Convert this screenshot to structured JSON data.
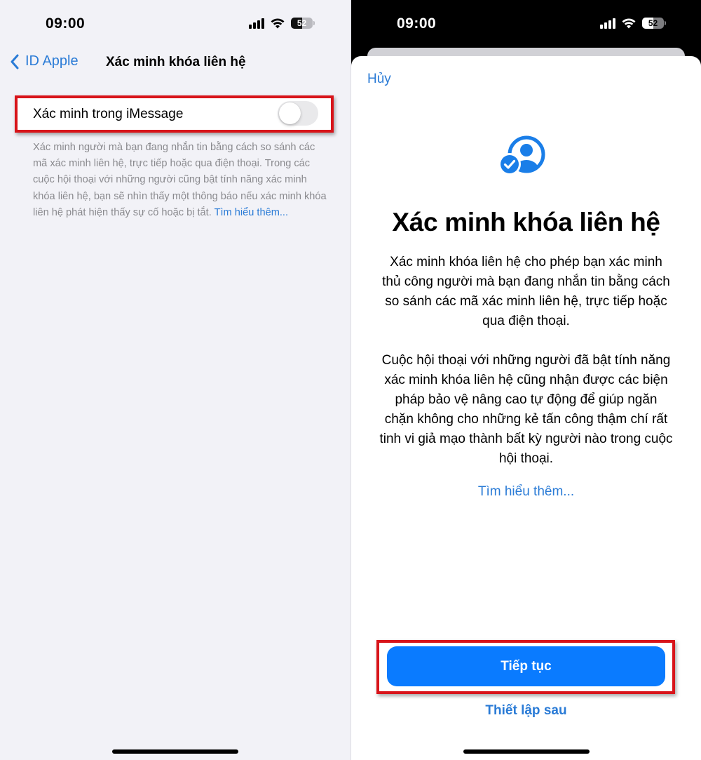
{
  "left_screen": {
    "status_bar": {
      "time": "09:00",
      "battery": "52"
    },
    "nav": {
      "back_label": "ID Apple",
      "title": "Xác minh khóa liên hệ"
    },
    "setting": {
      "label": "Xác minh trong iMessage",
      "toggle_on": false
    },
    "footer": {
      "text": "Xác minh người mà bạn đang nhắn tin bằng cách so sánh các mã xác minh liên hệ, trực tiếp hoặc qua điện thoại. Trong các cuộc hội thoại với những người cũng bật tính năng xác minh khóa liên hệ, bạn sẽ nhìn thấy một thông báo nếu xác minh khóa liên hệ phát hiện thấy sự cố hoặc bị tắt. ",
      "link": "Tìm hiểu thêm..."
    }
  },
  "right_screen": {
    "status_bar": {
      "time": "09:00",
      "battery": "52"
    },
    "sheet": {
      "cancel_label": "Hủy",
      "icon": "person-verified-icon",
      "title": "Xác minh khóa liên hệ",
      "body_1": "Xác minh khóa liên hệ cho phép bạn xác minh thủ công người mà bạn đang nhắn tin bằng cách so sánh các mã xác minh liên hệ, trực tiếp hoặc qua điện thoại.",
      "body_2": "Cuộc hội thoại với những người đã bật tính năng xác minh khóa liên hệ cũng nhận được các biện pháp bảo vệ nâng cao tự động để giúp ngăn chặn không cho những kẻ tấn công thậm chí rất tinh vi giả mạo thành bất kỳ người nào trong cuộc hội thoại.",
      "learn_more": "Tìm hiểu thêm...",
      "primary_button": "Tiếp tục",
      "secondary_button": "Thiết lập sau"
    }
  },
  "colors": {
    "accent": "#2a7bd6",
    "primary_button": "#0a7bff",
    "highlight": "#d8141a",
    "grouped_background": "#f2f2f7"
  }
}
